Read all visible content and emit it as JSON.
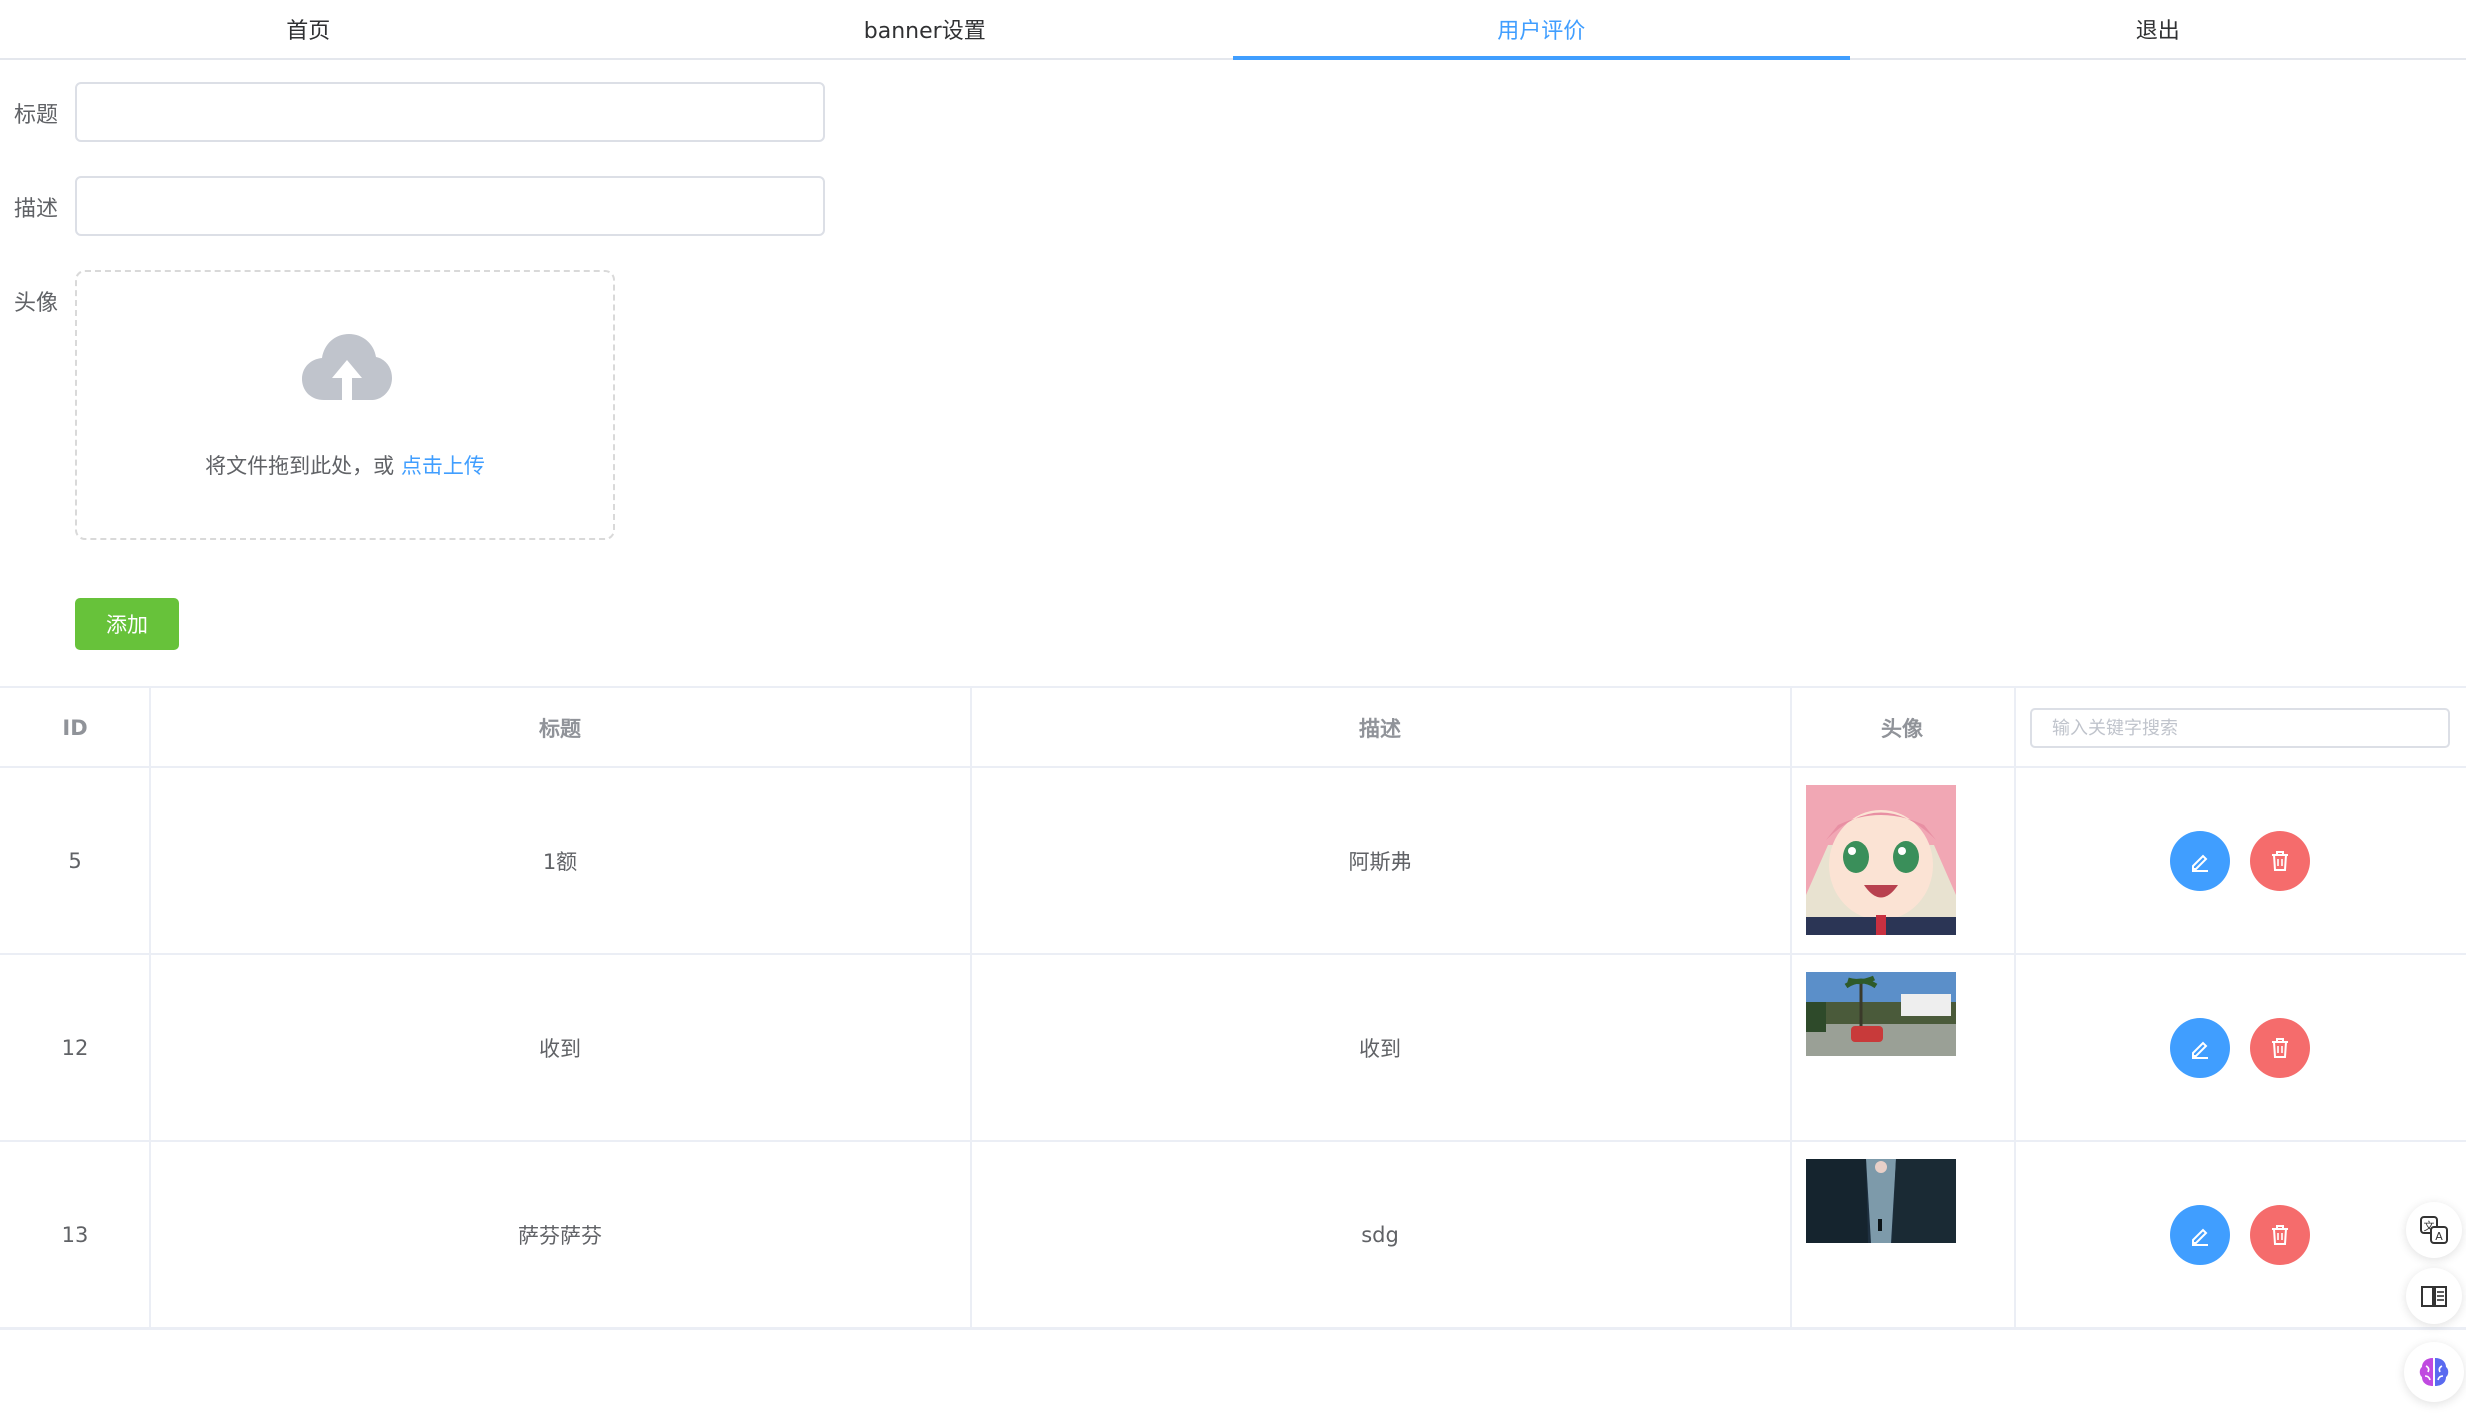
{
  "nav": {
    "items": [
      {
        "label": "首页"
      },
      {
        "label": "banner设置"
      },
      {
        "label": "用户评价"
      },
      {
        "label": "退出"
      }
    ],
    "active_index": 2
  },
  "form": {
    "title_label": "标题",
    "title_value": "",
    "desc_label": "描述",
    "desc_value": "",
    "avatar_label": "头像",
    "upload_text": "将文件拖到此处，或",
    "upload_link": "点击上传",
    "add_button": "添加"
  },
  "table": {
    "headers": {
      "id": "ID",
      "title": "标题",
      "desc": "描述",
      "avatar": "头像"
    },
    "search_placeholder": "输入关键字搜索",
    "rows": [
      {
        "id": "5",
        "title": "1额",
        "desc": "阿斯弗",
        "avatar": "anime-girl-pink-hair"
      },
      {
        "id": "12",
        "title": "收到",
        "desc": "收到",
        "avatar": "street-red-car-palm"
      },
      {
        "id": "13",
        "title": "萨芬萨芬",
        "desc": "sdg",
        "avatar": "dark-canyon-figure"
      }
    ]
  },
  "colors": {
    "primary": "#409eff",
    "success": "#67c23a",
    "danger": "#f56c6c",
    "border": "#ebeef5"
  },
  "floating_tools": [
    "translate-icon",
    "reader-icon",
    "ai-brain-icon"
  ]
}
